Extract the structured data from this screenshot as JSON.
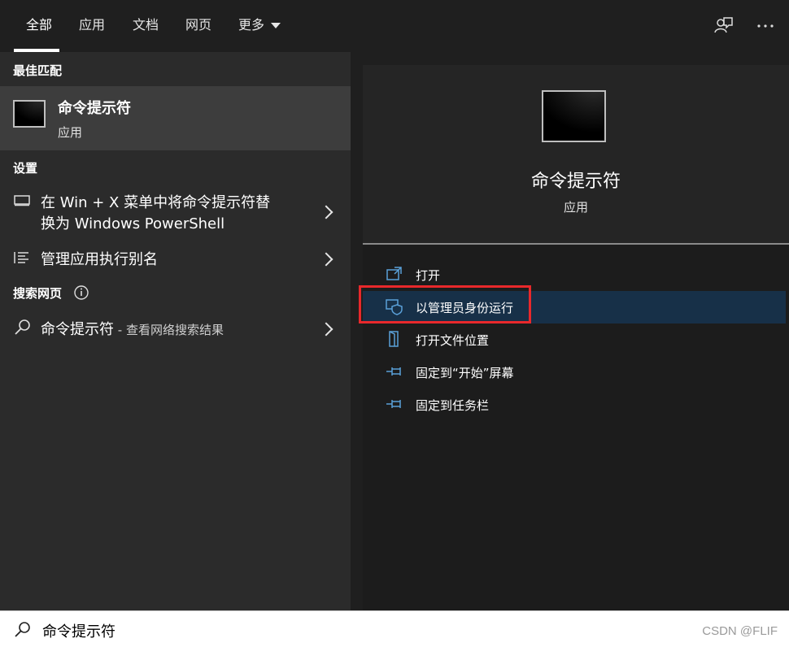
{
  "tabs": [
    {
      "label": "全部",
      "active": true
    },
    {
      "label": "应用"
    },
    {
      "label": "文档"
    },
    {
      "label": "网页"
    },
    {
      "label": "更多"
    }
  ],
  "top_icons": [
    "feedback-icon",
    "more-options-icon"
  ],
  "left_panel": {
    "best_match_heading": "最佳匹配",
    "best_match": {
      "title": "命令提示符",
      "subtitle": "应用",
      "icon": "cmd-app-icon"
    },
    "settings_heading": "设置",
    "settings_items": [
      {
        "line1": "在 Win + X 菜单中将命令提示符替",
        "line2": "换为 Windows PowerShell",
        "icon": "monitor-icon"
      },
      {
        "label": "管理应用执行别名",
        "icon": "list-icon"
      }
    ],
    "web_heading": "搜索网页",
    "web_item": {
      "query": "命令提示符",
      "suffix": " - 查看网络搜索结果",
      "icon": "search-icon"
    }
  },
  "right_panel": {
    "title": "命令提示符",
    "subtitle": "应用",
    "actions": [
      {
        "label": "打开",
        "icon": "open-icon"
      },
      {
        "label": "以管理员身份运行",
        "icon": "shield-icon",
        "highlighted": true
      },
      {
        "label": "打开文件位置",
        "icon": "file-location-icon"
      },
      {
        "label": "固定到“开始”屏幕",
        "icon": "pin-icon"
      },
      {
        "label": "固定到任务栏",
        "icon": "pin-icon"
      }
    ]
  },
  "search": {
    "value": "命令提示符"
  },
  "watermark": "CSDN @FLIF",
  "colors": {
    "accent_highlight": "#173048",
    "red_box": "#e8282b",
    "action_icon": "#5aa0d8"
  }
}
